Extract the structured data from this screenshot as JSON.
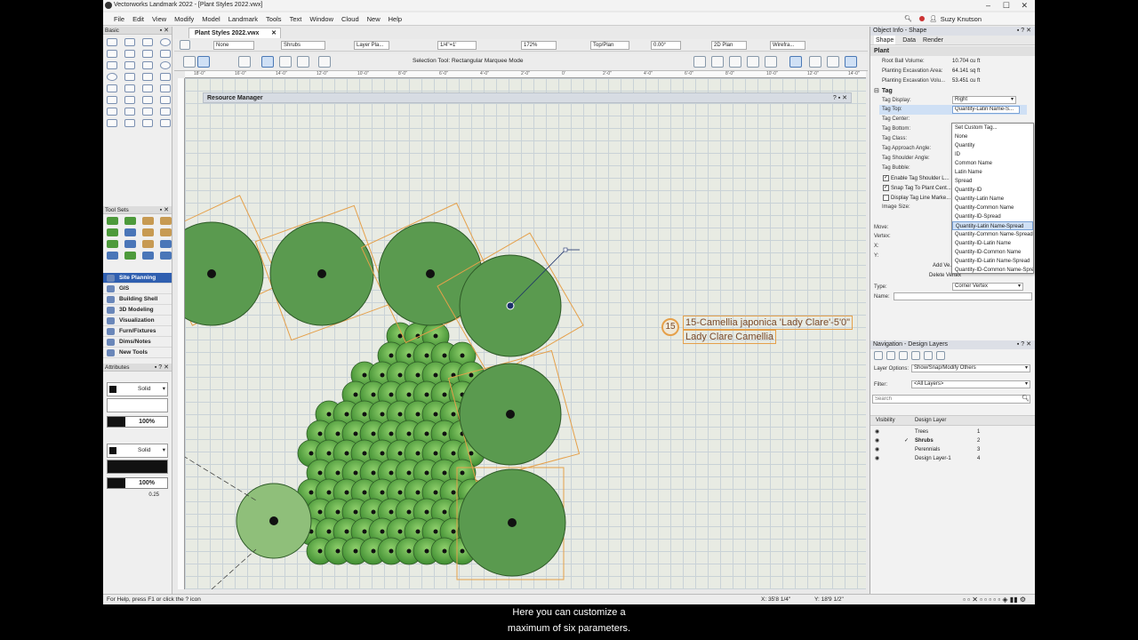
{
  "title": "Vectorworks Landmark 2022 - [Plant Styles 2022.vwx]",
  "menu": [
    "File",
    "Edit",
    "View",
    "Modify",
    "Model",
    "Landmark",
    "Tools",
    "Text",
    "Window",
    "Cloud",
    "New",
    "Help"
  ],
  "user": "Suzy Knutson",
  "doc_tab": "Plant Styles 2022.vwx",
  "left": {
    "basic_header": "Basic",
    "toolsets_header": "Tool Sets",
    "sets": [
      "Site Planning",
      "GIS",
      "Building Shell",
      "3D Modeling",
      "Visualization",
      "Furn/Fixtures",
      "Dims/Notes",
      "New Tools"
    ],
    "active_set": "Site Planning",
    "attributes_header": "Attributes",
    "fill_style": "Solid",
    "fill_opacity": "100%",
    "pen_style": "Solid",
    "pen_opacity": "100%",
    "pen_weight": "0.25"
  },
  "viewbar": {
    "class": "None",
    "layer_class": "Shrubs",
    "layer": "Layer Pla...",
    "scale": "1/4\"=1'",
    "zoom": "172%",
    "view": "Top/Plan",
    "angle": "0.00°",
    "projection": "2D Plan",
    "render": "Wirefra..."
  },
  "modebar": {
    "mode_label": "Selection Tool: Rectangular Marquee Mode"
  },
  "ruler_marks": [
    "18'-0\"",
    "16'-0\"",
    "14'-0\"",
    "12'-0\"",
    "10'-0\"",
    "8'-0\"",
    "6'-0\"",
    "4'-0\"",
    "2'-0\"",
    "0'",
    "2'-0\"",
    "4'-0\"",
    "6'-0\"",
    "8'-0\"",
    "10'-0\"",
    "12'-0\"",
    "14'-0\""
  ],
  "resource_manager": "Resource Manager",
  "tag": {
    "bubble": "15",
    "line1": "15-Camellia japonica 'Lady Clare'-5'0\"",
    "line2": "Lady Clare Camellia"
  },
  "object_info": {
    "header": "Object Info - Shape",
    "tabs": [
      "Shape",
      "Data",
      "Render"
    ],
    "section_plant": "Plant",
    "props_top": [
      {
        "label": "Root Ball Volume:",
        "value": "10.704 cu ft"
      },
      {
        "label": "Planting Excavation Area:",
        "value": "64.141 sq ft"
      },
      {
        "label": "Planting Excavation Volu...",
        "value": "53.451 cu ft"
      }
    ],
    "section_tag": "Tag",
    "tag_display_label": "Tag Display:",
    "tag_display_value": "Right",
    "tag_top_label": "Tag Top:",
    "tag_top_value": "Quantity-Latin Name-S...",
    "other_labels": [
      "Tag Center:",
      "Tag Bottom:",
      "Tag Class:",
      "Tag Approach Angle:",
      "Tag Shoulder Angle:",
      "Tag Bubble:"
    ],
    "checks": [
      {
        "label": "Enable Tag Shoulder L...",
        "checked": true
      },
      {
        "label": "Snap Tag To Plant Cent...",
        "checked": true
      },
      {
        "label": "Display Tag Line Marke...",
        "checked": false
      }
    ],
    "image_size": "Image Size:",
    "move": "Move:",
    "vertex": "Vertex:",
    "x": "X:",
    "y": "Y:",
    "add_vertex": "Add Ve...",
    "delete_vertex": "Delete Vertex",
    "type_label": "Type:",
    "type_value": "Corner Vertex",
    "name_label": "Name:"
  },
  "dropdown": [
    "Set Custom Tag...",
    "None",
    "Quantity",
    "ID",
    "Common Name",
    "Latin Name",
    "Spread",
    "Quantity-ID",
    "Quantity-Latin Name",
    "Quantity-Common Name",
    "Quantity-ID-Spread",
    "Quantity-Latin Name-Spread",
    "Quantity-Common Name-Spread",
    "Quantity-ID-Latin Name",
    "Quantity-ID-Common Name",
    "Quantity-ID-Latin Name-Spread",
    "Quantity-ID-Common Name-Spread"
  ],
  "dropdown_selected": "Quantity-Latin Name-Spread",
  "navigation": {
    "header": "Navigation - Design Layers",
    "layer_options_label": "Layer Options:",
    "layer_options_value": "Show/Snap/Modify Others",
    "filter_label": "Filter:",
    "filter_value": "<All Layers>",
    "search_placeholder": "Search",
    "col_visibility": "Visibility",
    "col_design_layer": "Design Layer",
    "layers": [
      {
        "name": "Trees",
        "num": "1",
        "active": false
      },
      {
        "name": "Shrubs",
        "num": "2",
        "active": true
      },
      {
        "name": "Perennials",
        "num": "3",
        "active": false
      },
      {
        "name": "Design Layer-1",
        "num": "4",
        "active": false
      }
    ]
  },
  "status": {
    "help": "For Help, press F1 or click the ? icon",
    "x": "X: 35'8 1/4\"",
    "y": "Y: 18'9 1/2\""
  },
  "captions": [
    "Here you can customize a",
    "maximum of six parameters."
  ]
}
